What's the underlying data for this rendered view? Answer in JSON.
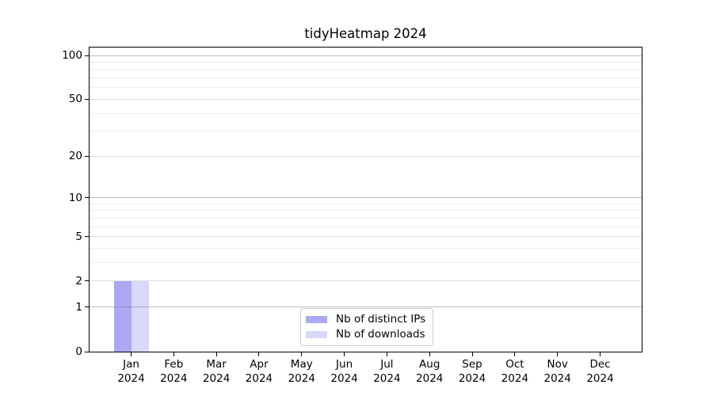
{
  "chart_data": {
    "type": "bar",
    "title": "tidyHeatmap 2024",
    "categories": [
      "Jan\n2024",
      "Feb\n2024",
      "Mar\n2024",
      "Apr\n2024",
      "May\n2024",
      "Jun\n2024",
      "Jul\n2024",
      "Aug\n2024",
      "Sep\n2024",
      "Oct\n2024",
      "Nov\n2024",
      "Dec\n2024"
    ],
    "series": [
      {
        "name": "Nb of distinct IPs",
        "color": "#a9a9f5",
        "values": [
          2,
          0,
          0,
          0,
          0,
          0,
          0,
          0,
          0,
          0,
          0,
          0
        ]
      },
      {
        "name": "Nb of downloads",
        "color": "#d8d8f8",
        "values": [
          2,
          0,
          0,
          0,
          0,
          0,
          0,
          0,
          0,
          0,
          0,
          0
        ]
      }
    ],
    "xlabel": "",
    "ylabel": "",
    "yscale": "log1p",
    "ylim": [
      0,
      114
    ],
    "yticks": [
      0,
      1,
      2,
      5,
      10,
      20,
      50,
      100
    ],
    "minor_yticks": [
      3,
      4,
      6,
      7,
      8,
      9,
      30,
      40,
      60,
      70,
      80,
      90
    ],
    "grid": "horizontal",
    "legend_position": "lower-center-inside",
    "colors": {
      "grid_strong": "rgba(110,110,110,0.45)",
      "grid_medium": "rgba(150,150,150,0.30)",
      "grid_minor": "rgba(170,170,170,0.22)",
      "axis": "#000000",
      "background": "#ffffff"
    },
    "grid_strong_at": [
      1,
      10,
      100
    ],
    "grid_medium_at": [
      2,
      5,
      20,
      50
    ]
  }
}
